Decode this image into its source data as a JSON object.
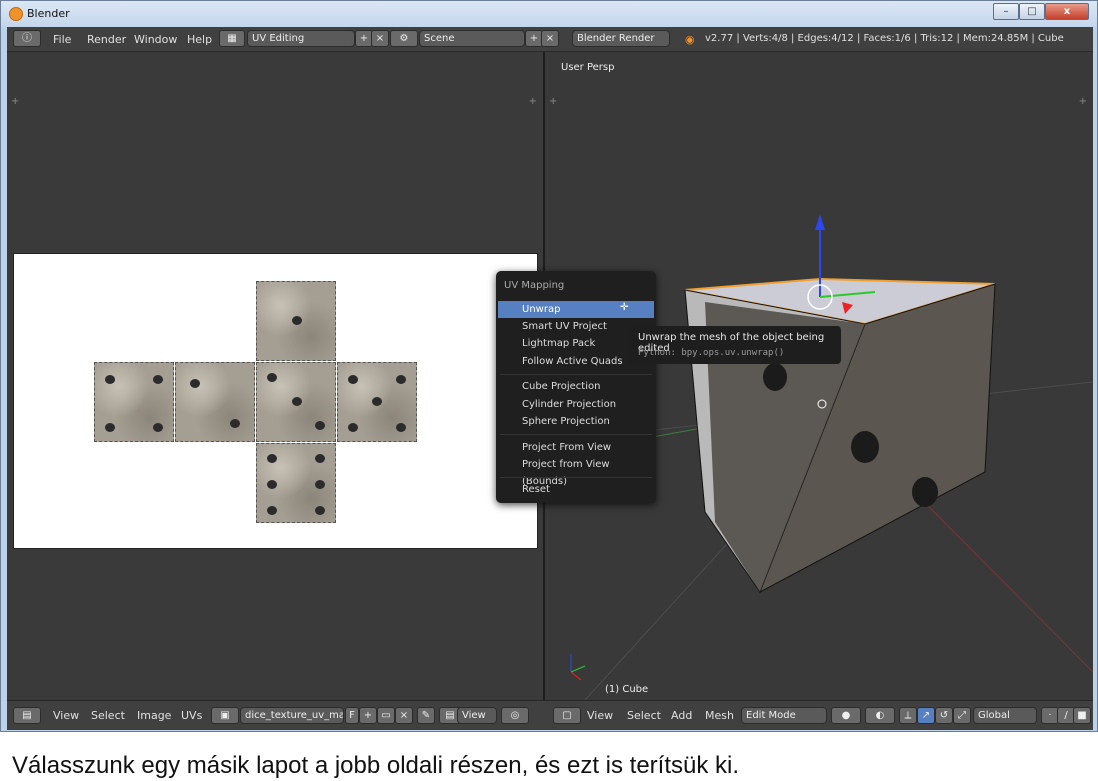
{
  "window": {
    "title": "Blender",
    "minimize": "–",
    "maximize": "□",
    "close": "x"
  },
  "topbar": {
    "menu": [
      "File",
      "Render",
      "Window",
      "Help"
    ],
    "layout": "UV Editing",
    "scene": "Scene",
    "engine": "Blender Render",
    "stats": "v2.77 | Verts:4/8 | Edges:4/12 | Faces:1/6 | Tris:12 | Mem:24.85M | Cube"
  },
  "viewport": {
    "label": "User Persp",
    "object": "(1) Cube"
  },
  "uv_menu": {
    "title": "UV Mapping",
    "items": [
      "Unwrap",
      "Smart UV Project",
      "Lightmap Pack",
      "Follow Active Quads",
      "Cube Projection",
      "Cylinder Projection",
      "Sphere Projection",
      "Project From View",
      "Project from View (Bounds)",
      "Reset"
    ],
    "active": "Unwrap"
  },
  "tooltip": {
    "text": "Unwrap the mesh of the object being edited",
    "python": "Python: bpy.ops.uv.unwrap()"
  },
  "bottom_left": {
    "items": [
      "View",
      "Select",
      "Image",
      "UVs"
    ],
    "image_name": "dice_texture_uv_ma...",
    "f": "F",
    "view": "View"
  },
  "bottom_right": {
    "items": [
      "View",
      "Select",
      "Add",
      "Mesh"
    ],
    "mode": "Edit Mode",
    "orientation": "Global"
  },
  "caption": "Válasszunk egy másik lapot a jobb oldali részen, és ezt is terítsük ki."
}
